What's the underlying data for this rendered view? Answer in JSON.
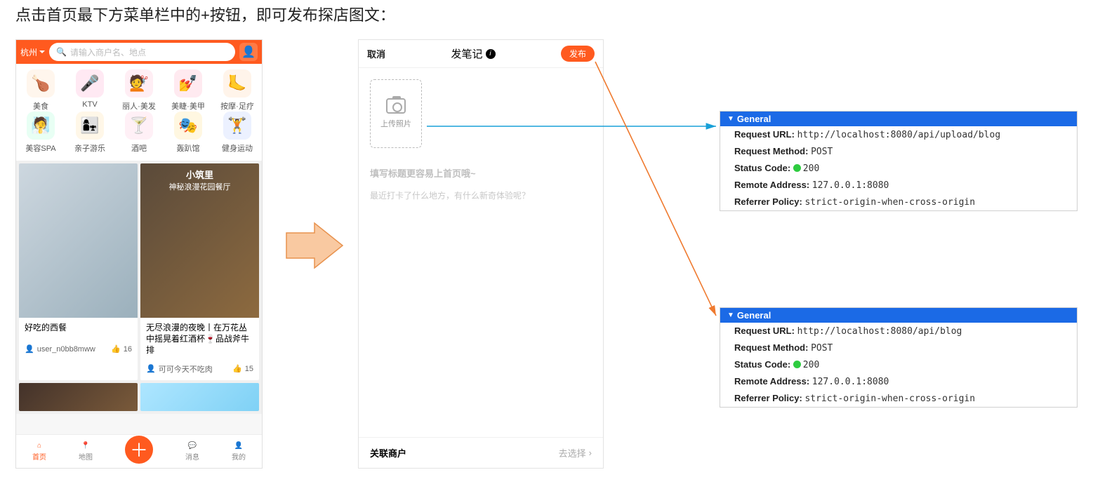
{
  "heading": "点击首页最下方菜单栏中的+按钮，即可发布探店图文：",
  "phone1": {
    "city": "杭州",
    "search_placeholder": "请输入商户名、地点",
    "categories": [
      {
        "label": "美食",
        "emoji": "🍗",
        "bg": "#fff6ed"
      },
      {
        "label": "KTV",
        "emoji": "🎤",
        "bg": "#ffe9f3"
      },
      {
        "label": "丽人·美发",
        "emoji": "💇",
        "bg": "#ffeef4"
      },
      {
        "label": "美睫·美甲",
        "emoji": "💅",
        "bg": "#ffeaf0"
      },
      {
        "label": "按摩·足疗",
        "emoji": "🦶",
        "bg": "#fff4ea"
      },
      {
        "label": "美容SPA",
        "emoji": "🧖",
        "bg": "#e8fff4"
      },
      {
        "label": "亲子游乐",
        "emoji": "👩‍👧",
        "bg": "#fff7e8"
      },
      {
        "label": "酒吧",
        "emoji": "🍸",
        "bg": "#fff0f6"
      },
      {
        "label": "轰趴馆",
        "emoji": "🎭",
        "bg": "#fff7e1"
      },
      {
        "label": "健身运动",
        "emoji": "🏋️",
        "bg": "#ecf1ff"
      }
    ],
    "feed": {
      "card1": {
        "title": "好吃的西餐",
        "user": "user_n0bb8mww",
        "likes": "16"
      },
      "card2": {
        "overlay_title": "小筑里",
        "overlay_sub": "神秘浪漫花园餐厅",
        "title": "无尽浪漫的夜晚丨在万花丛中摇晃着红酒杯🍷品战斧牛排",
        "user": "可可今天不吃肉",
        "likes": "15"
      }
    },
    "tabs": {
      "home": "首页",
      "map": "地图",
      "msg": "消息",
      "mine": "我的"
    }
  },
  "phone2": {
    "header": {
      "cancel": "取消",
      "title": "发笔记",
      "publish": "发布"
    },
    "upload_label": "上传照片",
    "field_title_placeholder": "填写标题更容易上首页哦~",
    "field_body_placeholder": "最近打卡了什么地方，有什么新奇体验呢？",
    "related_merchant_label": "关联商户",
    "select_label": "去选择"
  },
  "devtools": {
    "section": "General",
    "labels": {
      "request_url": "Request URL:",
      "request_method": "Request Method:",
      "status_code": "Status Code:",
      "remote_address": "Remote Address:",
      "referrer_policy": "Referrer Policy:"
    },
    "panel1": {
      "url": "http://localhost:8080/api/upload/blog",
      "method": "POST",
      "status": "200",
      "remote": "127.0.0.1:8080",
      "referrer": "strict-origin-when-cross-origin"
    },
    "panel2": {
      "url": "http://localhost:8080/api/blog",
      "method": "POST",
      "status": "200",
      "remote": "127.0.0.1:8080",
      "referrer": "strict-origin-when-cross-origin"
    }
  },
  "like_icon": "👍"
}
